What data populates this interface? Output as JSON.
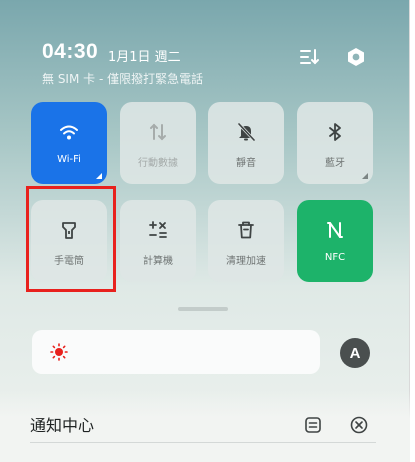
{
  "header": {
    "time": "04:30",
    "date": "1月1日 週二",
    "sim_status": "無 SIM 卡 - 僅限撥打緊急電話",
    "edit_icon": "sort-edit-icon",
    "settings_icon": "hexagon-settings-icon"
  },
  "tiles": [
    {
      "label": "Wi-Fi",
      "icon": "wifi-icon",
      "state": "on",
      "color": "#1a73e8"
    },
    {
      "label": "行動數據",
      "icon": "mobile-data-icon",
      "state": "disabled"
    },
    {
      "label": "靜音",
      "icon": "bell-off-icon",
      "state": "off"
    },
    {
      "label": "藍牙",
      "icon": "bluetooth-icon",
      "state": "off"
    },
    {
      "label": "手電筒",
      "icon": "flashlight-icon",
      "state": "off",
      "highlighted": true
    },
    {
      "label": "計算機",
      "icon": "calculator-icon",
      "state": "off"
    },
    {
      "label": "清理加速",
      "icon": "trash-icon",
      "state": "off"
    },
    {
      "label": "NFC",
      "icon": "nfc-icon",
      "state": "on",
      "color": "#1db36a"
    }
  ],
  "brightness": {
    "icon": "sun-icon",
    "auto_label": "A",
    "color": "#e8211d"
  },
  "notifications": {
    "title": "通知中心",
    "manage_icon": "notification-manage-icon",
    "clear_icon": "clear-all-icon"
  },
  "highlight_color": "#e8211d"
}
